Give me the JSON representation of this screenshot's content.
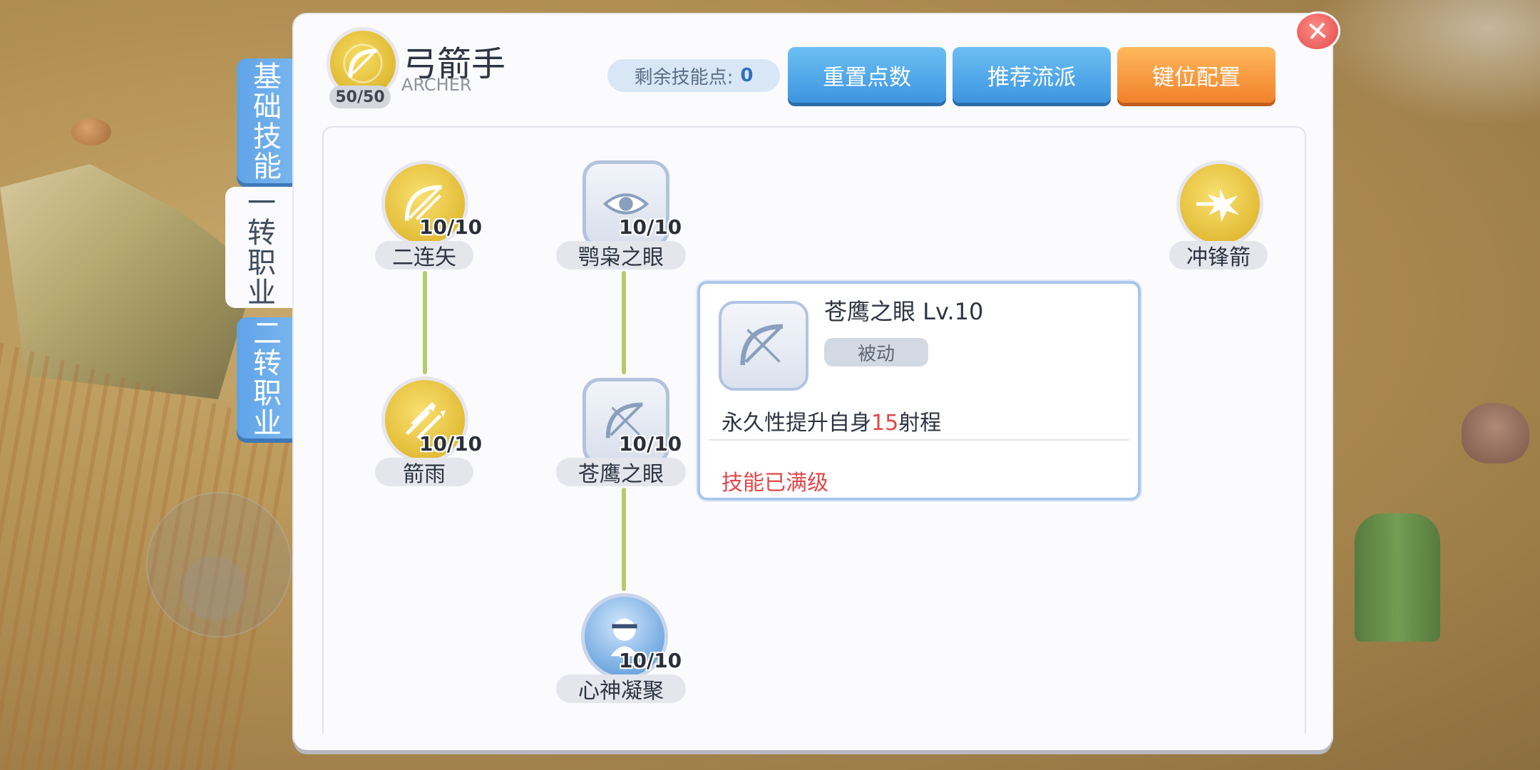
{
  "tabs": [
    {
      "label": "基础技能"
    },
    {
      "label": "一转职业"
    },
    {
      "label": "二转职业"
    }
  ],
  "header": {
    "class_name": "弓箭手",
    "class_name_en": "ARCHER",
    "class_level": "50/50",
    "skill_points_label": "剩余技能点:",
    "skill_points_value": "0",
    "reset_label": "重置点数",
    "recommend_label": "推荐流派",
    "keybind_label": "键位配置"
  },
  "skills": [
    {
      "name": "二连矢",
      "level": "10/10",
      "icon": "bow-arrow-icon"
    },
    {
      "name": "箭雨",
      "level": "10/10",
      "icon": "arrow-rain-icon"
    },
    {
      "name": "鹗枭之眼",
      "level": "10/10",
      "icon": "eye-icon"
    },
    {
      "name": "苍鹰之眼",
      "level": "10/10",
      "icon": "bow-icon"
    },
    {
      "name": "心神凝聚",
      "level": "10/10",
      "icon": "meditation-icon"
    },
    {
      "name": "冲锋箭",
      "level": "",
      "icon": "charge-arrow-icon"
    }
  ],
  "tooltip": {
    "title": "苍鹰之眼 Lv.10",
    "type": "被动",
    "desc_prefix": "永久性提升自身",
    "desc_value": "15",
    "desc_suffix": "射程",
    "status": "技能已满级"
  },
  "colors": {
    "tab_blue": "#5fa3e8",
    "button_blue": "#3d95e0",
    "button_orange": "#f2822b",
    "gold": "#d9ad1f",
    "connector": "#b6cc6a",
    "highlight_red": "#e0474a"
  }
}
